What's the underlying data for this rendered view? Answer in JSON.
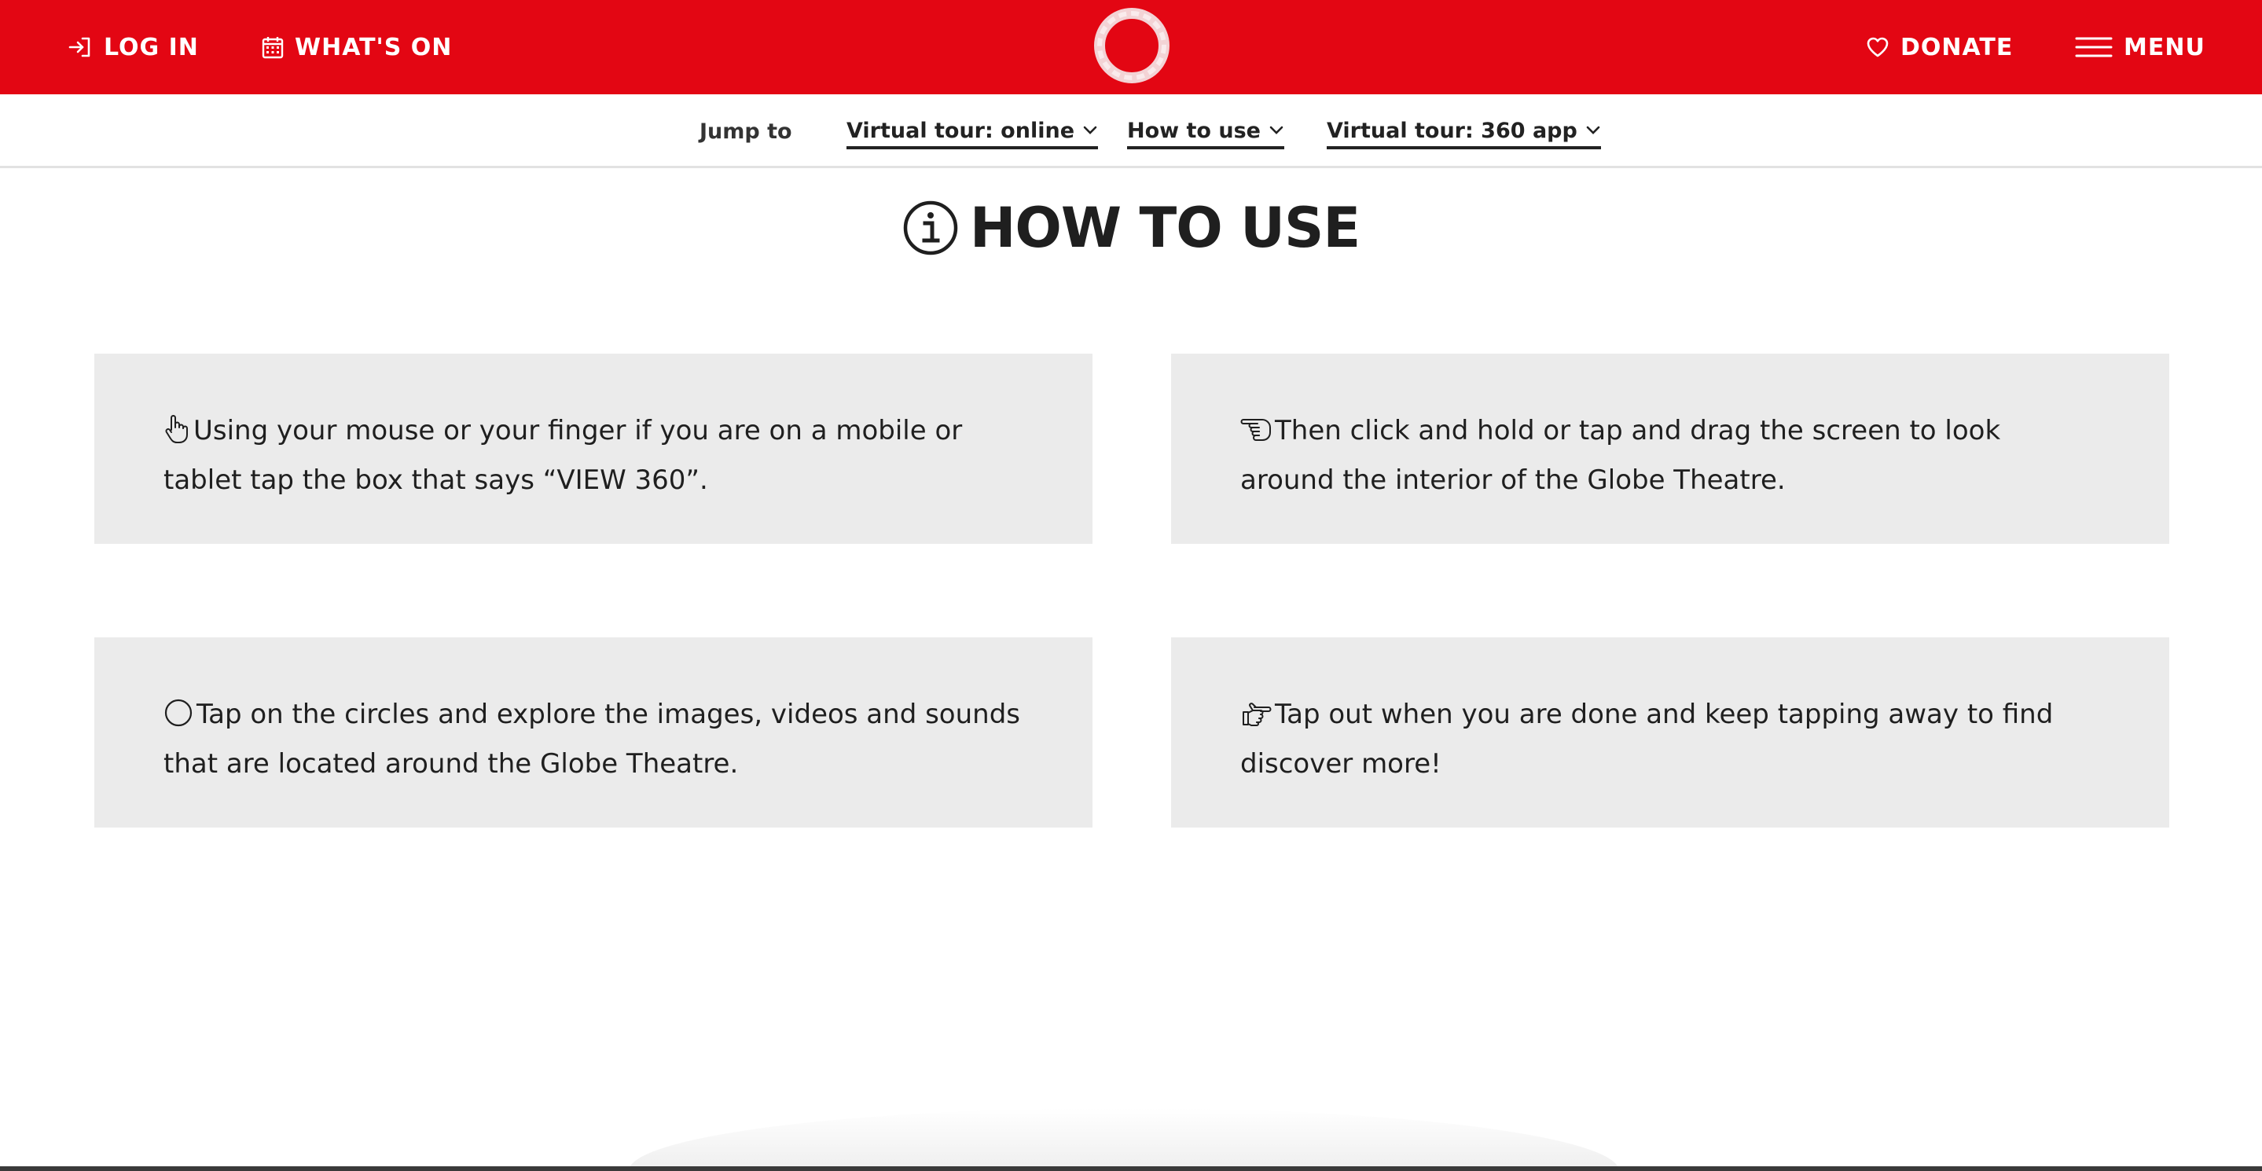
{
  "header": {
    "login_label": "LOG IN",
    "whats_on_label": "WHAT'S ON",
    "donate_label": "DONATE",
    "menu_label": "MENU",
    "brand_color": "#e30613"
  },
  "jump_bar": {
    "label": "Jump to",
    "links": [
      {
        "label": "Virtual tour: online"
      },
      {
        "label": "How to use"
      },
      {
        "label": "Virtual tour: 360 app"
      }
    ]
  },
  "section": {
    "title": "HOW TO USE",
    "steps": [
      {
        "icon": "hand-pointer-icon",
        "text": "Using your mouse or your finger if you are on a mobile or tablet tap the box that says “VIEW 360”."
      },
      {
        "icon": "hand-point-left-icon",
        "text": "Then click and hold or tap and drag the screen to look around the interior of the Globe Theatre."
      },
      {
        "icon": "circle-icon",
        "text": "Tap on the circles and explore the images, videos and sounds that are located around the Globe Theatre."
      },
      {
        "icon": "hand-point-right-icon",
        "text": "Tap out when you are done and keep tapping away to find discover more!"
      }
    ]
  }
}
